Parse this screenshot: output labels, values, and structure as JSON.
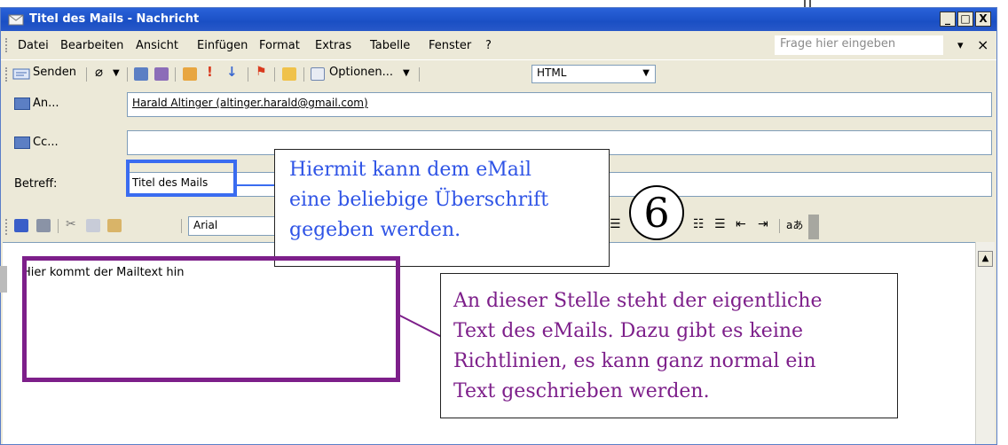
{
  "window": {
    "title": "Titel des Mails - Nachricht",
    "controls": [
      "_",
      "□",
      "X"
    ]
  },
  "menubar": {
    "items": [
      "Datei",
      "Bearbeiten",
      "Ansicht",
      "Einfügen",
      "Format",
      "Extras",
      "Tabelle",
      "Fenster",
      "?"
    ],
    "help_placeholder": "Frage hier eingeben",
    "dropdown_glyph": "▾",
    "close_glyph": "×"
  },
  "toolbar": {
    "send_label": "Senden",
    "options_label": "Optionen...",
    "format_value": "HTML"
  },
  "header": {
    "to_label": "An...",
    "to_value": "Harald Altinger (altinger.harald@gmail.com)",
    "cc_label": "Cc...",
    "cc_value": "",
    "subject_label": "Betreff:",
    "subject_value": "Titel des Mails"
  },
  "format_toolbar": {
    "font_value": "Arial"
  },
  "body": {
    "text": "Hier kommt der Mailtext hin"
  },
  "annotations": {
    "subject_callout": [
      "Hiermit kann dem eMail",
      "eine beliebige Überschrift",
      "gegeben werden."
    ],
    "step_number": "6",
    "body_callout": [
      "An dieser Stelle steht der eigentliche",
      "Text des eMails. Dazu gibt es keine",
      "Richtlinien, es kann ganz normal ein",
      "Text geschrieben werden."
    ],
    "colors": {
      "subject": "#3a6cf0",
      "body": "#7d1f8a"
    }
  }
}
